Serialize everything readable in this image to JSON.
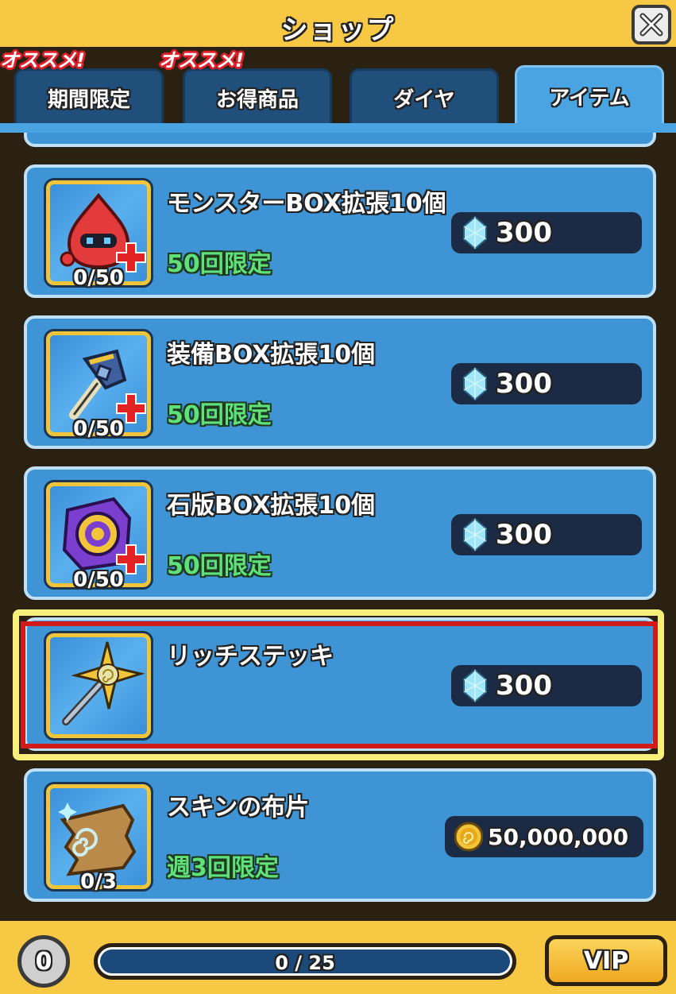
{
  "header": {
    "title": "ショップ",
    "close_icon": "close-x-icon"
  },
  "tabs": [
    {
      "label": "期間限定",
      "badge": "オススメ!",
      "active": false
    },
    {
      "label": "お得商品",
      "badge": "オススメ!",
      "active": false
    },
    {
      "label": "ダイヤ",
      "badge": "",
      "active": false
    },
    {
      "label": "アイテム",
      "badge": "",
      "active": true
    }
  ],
  "items": [
    {
      "name": "モンスターBOX拡張10個",
      "limit": "50回限定",
      "count": "0/50",
      "price": "300",
      "currency": "diamond",
      "icon": "monster-box-icon"
    },
    {
      "name": "装備BOX拡張10個",
      "limit": "50回限定",
      "count": "0/50",
      "price": "300",
      "currency": "diamond",
      "icon": "equipment-box-icon"
    },
    {
      "name": "石版BOX拡張10個",
      "limit": "50回限定",
      "count": "0/50",
      "price": "300",
      "currency": "diamond",
      "icon": "stone-tablet-box-icon"
    },
    {
      "name": "リッチステッキ",
      "limit": "",
      "count": "",
      "price": "300",
      "currency": "diamond",
      "icon": "rich-staff-icon",
      "selected": true
    },
    {
      "name": "スキンの布片",
      "limit": "週3回限定",
      "count": "0/3",
      "price": "50,000,000",
      "currency": "coin",
      "icon": "skin-cloth-icon"
    }
  ],
  "footer": {
    "rank": "0",
    "progress_label": "0 / 25",
    "progress_value": 0,
    "progress_max": 25,
    "vip_label": "VIP"
  },
  "colors": {
    "header_bg": "#f7c844",
    "card_bg": "#3f94d6",
    "limit_green": "#5fe07a",
    "selected_border": "#d11a1a",
    "selected_glow": "#f7ef7a"
  }
}
